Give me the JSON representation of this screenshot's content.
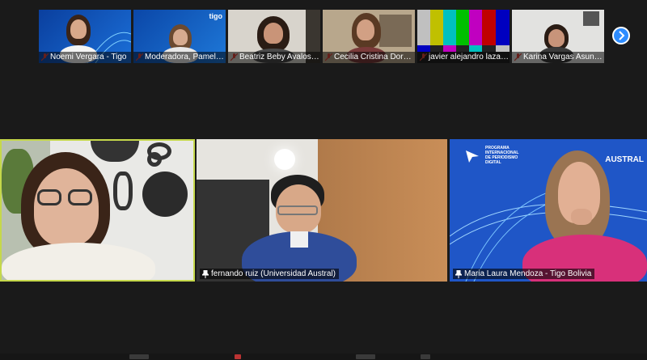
{
  "participants_strip": [
    {
      "name": "Noemi Vergara - Tigo",
      "muted": true
    },
    {
      "name": "Moderadora, Pamela...",
      "muted": true
    },
    {
      "name": "Beatriz Beby Avalos R...",
      "muted": true
    },
    {
      "name": "Cecilia Cristina Dorad...",
      "muted": true
    },
    {
      "name": "javier alejandro lazart...",
      "muted": true
    },
    {
      "name": "Karina Vargas Asunto...",
      "muted": true
    }
  ],
  "thumb_overlays": {
    "tigo_logo": "tigo",
    "brand_small": "tigo"
  },
  "main_tiles": [
    {
      "name": "",
      "speaking": true
    },
    {
      "name": "fernando ruiz (Universidad Austral)"
    },
    {
      "name": "Maria Laura Mendoza - Tigo Bolivia"
    }
  ],
  "austral_background": {
    "program_line1": "PROGRAMA",
    "program_line2": "INTERNACIONAL",
    "program_line3": "DE PERIODISMO",
    "program_line4": "DIGITAL",
    "brand": "AUSTRAL"
  },
  "colors": {
    "active_speaker_border": "#c5d84a",
    "muted_mic": "#e0453a",
    "next_button": "#2d8cff"
  }
}
